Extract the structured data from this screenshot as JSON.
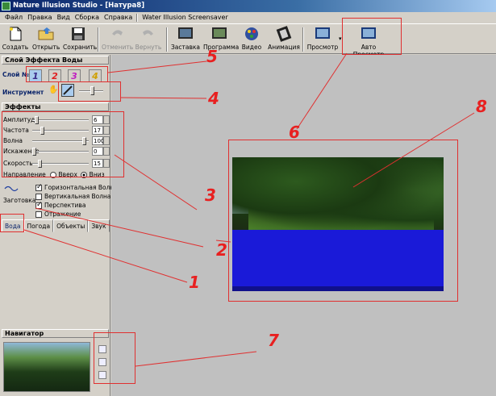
{
  "window": {
    "title": "Nature Illusion Studio - [Натура8]"
  },
  "menu": [
    "Файл",
    "Правка",
    "Вид",
    "Сборка",
    "Справка",
    "Water Illusion Screensaver"
  ],
  "toolbar": {
    "create": "Создать",
    "open": "Открыть",
    "save": "Сохранить",
    "undo": "Отменить",
    "redo": "Вернуть",
    "screensaver": "Заставка",
    "program": "Программа",
    "video": "Видео",
    "animation": "Анимация",
    "preview": "Просмотр",
    "auto_preview": "Авто Просмотр"
  },
  "left": {
    "water_layer_title": "Слой Эффекта Воды",
    "layer_no_label": "Слой №",
    "layers": [
      "1",
      "2",
      "3",
      "4"
    ],
    "tool_label": "Инструмент",
    "effects_title": "Эффекты",
    "sliders": [
      {
        "label": "Амплитуда",
        "value": "6",
        "level": 0.05
      },
      {
        "label": "Частота",
        "value": "17",
        "level": 0.15
      },
      {
        "label": "Волна",
        "value": "100",
        "level": 0.95
      },
      {
        "label": "Искажение",
        "value": "0",
        "level": 0.0
      },
      {
        "label": "Скорость",
        "value": "15",
        "level": 0.1
      }
    ],
    "direction_label": "Направление",
    "direction_up": "Вверх",
    "direction_down": "Вниз",
    "template_label": "Заготовка",
    "checkboxes": [
      {
        "label": "Горизонтальная Волна",
        "checked": true
      },
      {
        "label": "Вертикальная Волна",
        "checked": false
      },
      {
        "label": "Перспектива",
        "checked": true
      },
      {
        "label": "Отражение",
        "checked": false
      }
    ],
    "tabs": [
      "Вода",
      "Погода",
      "Объекты",
      "Звук"
    ],
    "navigator_title": "Навигатор"
  },
  "annotations": [
    "1",
    "2",
    "3",
    "4",
    "5",
    "6",
    "7",
    "8"
  ],
  "colors": {
    "annotation": "#e82020",
    "water": "#1a1ad8",
    "titlebar": "#0a246a"
  }
}
